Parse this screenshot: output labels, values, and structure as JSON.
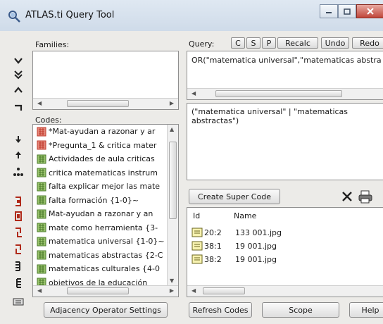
{
  "window": {
    "title": "ATLAS.ti Query Tool"
  },
  "families": {
    "label": "Families:"
  },
  "codes": {
    "label": "Codes:",
    "items": [
      {
        "text": "*Mat-ayudan a razonar y ar",
        "icon": "red-code-icon"
      },
      {
        "text": "*Pregunta_1 & critica mater",
        "icon": "red-code-icon"
      },
      {
        "text": "Actividades de aula criticas",
        "icon": "code-icon"
      },
      {
        "text": "critica matematicas instrum",
        "icon": "code-icon"
      },
      {
        "text": "falta explicar mejor las mate",
        "icon": "code-icon"
      },
      {
        "text": "falta formación {1-0}~",
        "icon": "code-icon"
      },
      {
        "text": "Mat-ayudan a razonar y an",
        "icon": "code-icon"
      },
      {
        "text": "mate como herramienta {3-",
        "icon": "code-icon"
      },
      {
        "text": "matematica universal {1-0}~",
        "icon": "code-icon"
      },
      {
        "text": "matematicas abstractas {2-C",
        "icon": "code-icon"
      },
      {
        "text": "matematicas culturales {4-0",
        "icon": "code-icon"
      },
      {
        "text": "objetivos de la educación",
        "icon": "code-icon"
      }
    ]
  },
  "query": {
    "label": "Query:",
    "buttons": [
      "C",
      "S",
      "P",
      "Recalc",
      "Undo",
      "Redo"
    ],
    "expression": "OR(\"matematica universal\",\"matematicas abstra",
    "result_text": "(\"matematica universal\" | \"matematicas abstractas\")"
  },
  "buttons": {
    "create_super_code": "Create Super Code",
    "adjacency": "Adjacency Operator Settings",
    "refresh": "Refresh Codes",
    "scope": "Scope",
    "help": "Help"
  },
  "results": {
    "columns": [
      "Id",
      "Name"
    ],
    "rows": [
      {
        "id": "20:2",
        "name": "133 001.jpg"
      },
      {
        "id": "38:1",
        "name": "19 001.jpg"
      },
      {
        "id": "38:2",
        "name": "19 001.jpg"
      }
    ]
  }
}
